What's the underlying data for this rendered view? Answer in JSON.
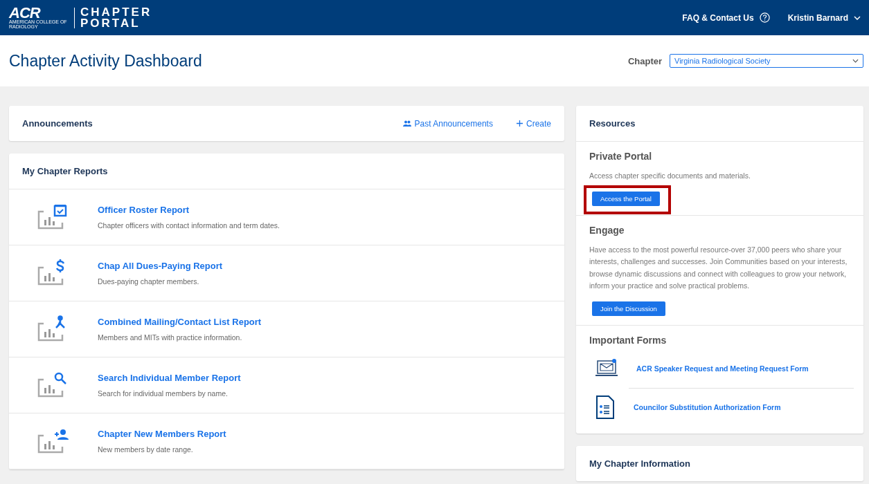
{
  "header": {
    "logo": {
      "mark": "ACR",
      "subtitle": "AMERICAN COLLEGE OF RADIOLOGY",
      "title_line_1": "CHAPTER",
      "title_line_2": "PORTAL"
    },
    "help_link": "FAQ & Contact Us",
    "user_menu": "Kristin Barnard"
  },
  "page_title": "Chapter Activity Dashboard",
  "chapter_select": {
    "label": "Chapter",
    "value": "Virginia Radiological Society"
  },
  "announcements": {
    "title": "Announcements",
    "past_link": "Past Announcements",
    "create_link": "Create"
  },
  "reports": {
    "title": "My Chapter Reports",
    "items": [
      {
        "kind": "calendar",
        "title": "Officer Roster Report",
        "description": "Chapter officers with contact information and term dates."
      },
      {
        "kind": "dollar",
        "title": "Chap All Dues-Paying Report",
        "description": "Dues-paying chapter members."
      },
      {
        "kind": "network",
        "title": "Combined Mailing/Contact List Report",
        "description": "Members and MITs with practice information."
      },
      {
        "kind": "search",
        "title": "Search Individual Member Report",
        "description": "Search for individual members by name."
      },
      {
        "kind": "person-add",
        "title": "Chapter New Members Report",
        "description": "New members by date range."
      }
    ]
  },
  "resources": {
    "title": "Resources",
    "sections": [
      {
        "title": "Private Portal",
        "text": "Access chapter specific documents and materials.",
        "button": "Access the Portal",
        "highlighted": true
      },
      {
        "title": "Engage",
        "text": "Have access to the most powerful resource-over 37,000 peers who share your interests, challenges and successes. Join Communities based on your interests, browse dynamic discussions and connect with colleagues to grow your network, inform your practice and solve practical problems.",
        "button": "Join the Discussion",
        "highlighted": false
      }
    ],
    "forms_title": "Important Forms",
    "forms": [
      {
        "kind": "mail",
        "label": "ACR Speaker Request and Meeting Request Form"
      },
      {
        "kind": "document",
        "label": "Councilor Substitution Authorization Form"
      }
    ]
  },
  "chapter_info": {
    "title": "My Chapter Information"
  }
}
